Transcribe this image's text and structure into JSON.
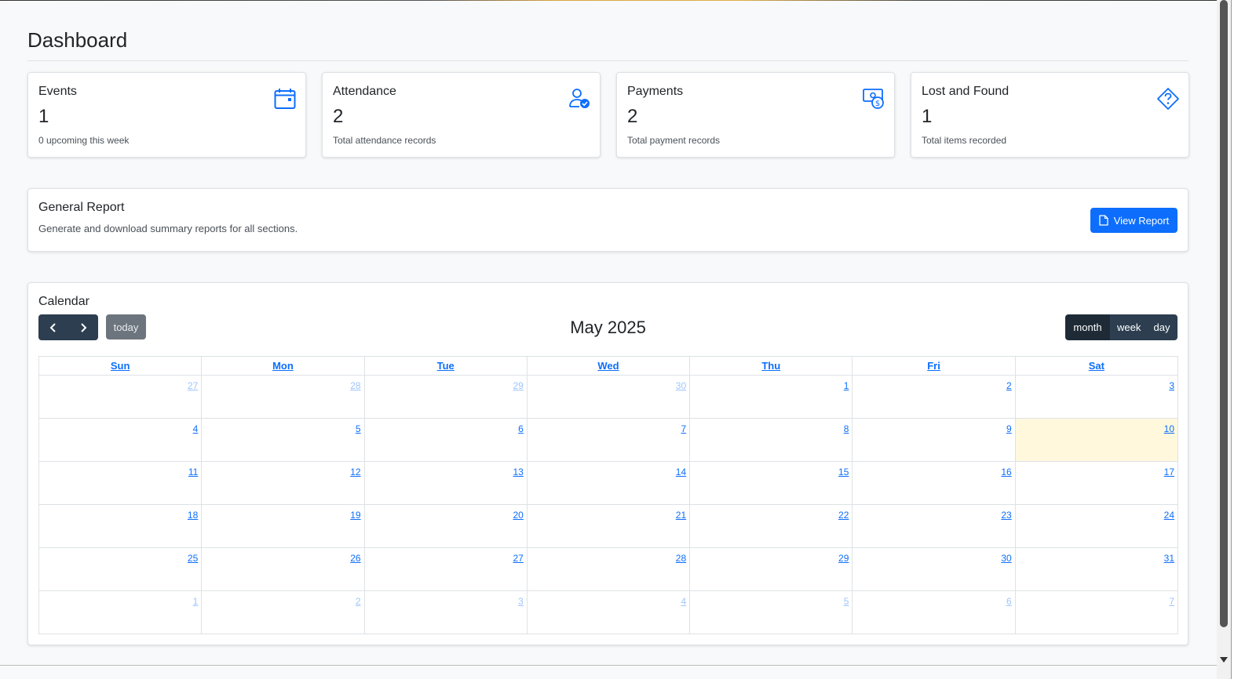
{
  "page": {
    "title": "Dashboard"
  },
  "stats": [
    {
      "label": "Events",
      "value": "1",
      "sub": "0 upcoming this week",
      "icon": "calendar-icon"
    },
    {
      "label": "Attendance",
      "value": "2",
      "sub": "Total attendance records",
      "icon": "user-check-icon"
    },
    {
      "label": "Payments",
      "value": "2",
      "sub": "Total payment records",
      "icon": "cash-coin-icon"
    },
    {
      "label": "Lost and Found",
      "value": "1",
      "sub": "Total items recorded",
      "icon": "question-diamond-icon"
    }
  ],
  "report": {
    "title": "General Report",
    "description": "Generate and download summary reports for all sections.",
    "button_label": "View Report",
    "button_icon": "document-icon"
  },
  "calendar": {
    "title": "Calendar",
    "month_title": "May 2025",
    "today_label": "today",
    "views": [
      "month",
      "week",
      "day"
    ],
    "active_view": "month",
    "weekdays": [
      "Sun",
      "Mon",
      "Tue",
      "Wed",
      "Thu",
      "Fri",
      "Sat"
    ],
    "weeks": [
      [
        "27",
        "28",
        "29",
        "30",
        "1",
        "2",
        "3"
      ],
      [
        "4",
        "5",
        "6",
        "7",
        "8",
        "9",
        "10"
      ],
      [
        "11",
        "12",
        "13",
        "14",
        "15",
        "16",
        "17"
      ],
      [
        "18",
        "19",
        "20",
        "21",
        "22",
        "23",
        "24"
      ],
      [
        "25",
        "26",
        "27",
        "28",
        "29",
        "30",
        "31"
      ],
      [
        "1",
        "2",
        "3",
        "4",
        "5",
        "6",
        "7"
      ]
    ],
    "today_date": "10",
    "colors": {
      "accent": "#0d6efd",
      "nav": "#2c3e50",
      "today_bg": "#fff8dd"
    }
  }
}
